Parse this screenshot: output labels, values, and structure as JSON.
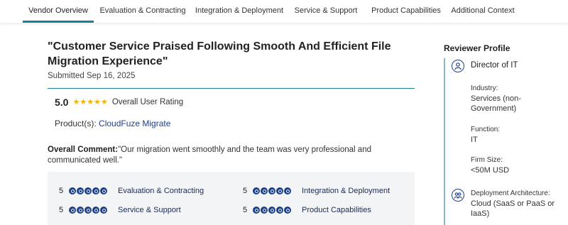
{
  "tabs": [
    {
      "label": "Vendor Overview",
      "active": true
    },
    {
      "label": "Evaluation & Contracting",
      "active": false
    },
    {
      "label": "Integration & Deployment",
      "active": false
    },
    {
      "label": "Service & Support",
      "active": false
    },
    {
      "label": "Product Capabilities",
      "active": false
    },
    {
      "label": "Additional Context",
      "active": false
    }
  ],
  "review": {
    "title": "\"Customer Service Praised Following Smooth And Efficient File Migration Experience\"",
    "submitted": "Submitted Sep 16, 2025",
    "overall_rating": "5.0",
    "star_count": 5,
    "overall_rating_label": "Overall User Rating",
    "products_label": "Product(s):",
    "product_name": "CloudFuze Migrate",
    "comment_label": "Overall Comment:",
    "comment_text": "\"Our migration went smoothly and the team was very professional and communicated well.\""
  },
  "scores": [
    {
      "value": "5",
      "dots": 5,
      "label": "Evaluation & Contracting"
    },
    {
      "value": "5",
      "dots": 5,
      "label": "Integration & Deployment"
    },
    {
      "value": "5",
      "dots": 5,
      "label": "Service & Support"
    },
    {
      "value": "5",
      "dots": 5,
      "label": "Product Capabilities"
    }
  ],
  "reviewer": {
    "heading": "Reviewer Profile",
    "role": "Director of IT",
    "industry_label": "Industry:",
    "industry_value": "Services (non-Government)",
    "function_label": "Function:",
    "function_value": "IT",
    "firm_size_label": "Firm Size:",
    "firm_size_value": "<50M USD",
    "deployment_label": "Deployment Architecture:",
    "deployment_value": "Cloud (SaaS or PaaS or IaaS)"
  },
  "colors": {
    "accent": "#1b7f96",
    "brand_blue": "#1c3f8a",
    "star": "#f5b301"
  },
  "icons": {
    "role": "person-icon",
    "deployment": "group-icon"
  }
}
